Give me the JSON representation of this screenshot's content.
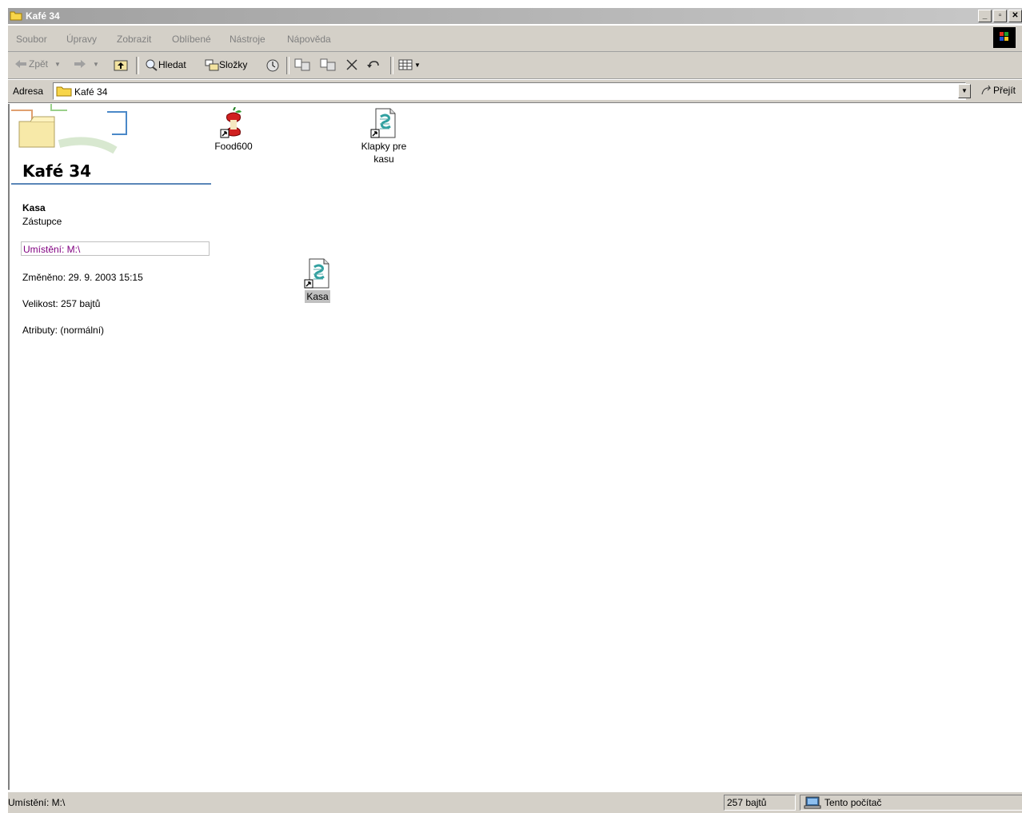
{
  "window": {
    "title": "Kafé 34",
    "buttons": {
      "minimize": "_",
      "maximize": "▫",
      "close": "✕"
    }
  },
  "menu": {
    "items": [
      "Soubor",
      "Úpravy",
      "Zobrazit",
      "Oblíbené",
      "Nástroje",
      "Nápověda"
    ]
  },
  "toolbar": {
    "back_label": "Zpět",
    "search_label": "Hledat",
    "folders_label": "Složky"
  },
  "address": {
    "label": "Adresa",
    "value": "Kafé 34",
    "go_label": "Přejít"
  },
  "details_panel": {
    "folder_title": "Kafé 34",
    "item_name": "Kasa",
    "item_type": "Zástupce",
    "location": "Umístění: M:\\",
    "modified": "Změněno: 29. 9. 2003 15:15",
    "size": "Velikost: 257 bajtů",
    "attributes": "Atributy: (normální)"
  },
  "files": [
    {
      "label": "Food600",
      "icon": "apple-core-shortcut-icon"
    },
    {
      "label": "Klapky pre kasu",
      "icon": "script-shortcut-icon"
    },
    {
      "label": "Kasa",
      "icon": "script-shortcut-icon",
      "selected": true
    }
  ],
  "status": {
    "location": "Umístění: M:\\",
    "size": "257 bajtů",
    "zone": "Tento počítač"
  }
}
